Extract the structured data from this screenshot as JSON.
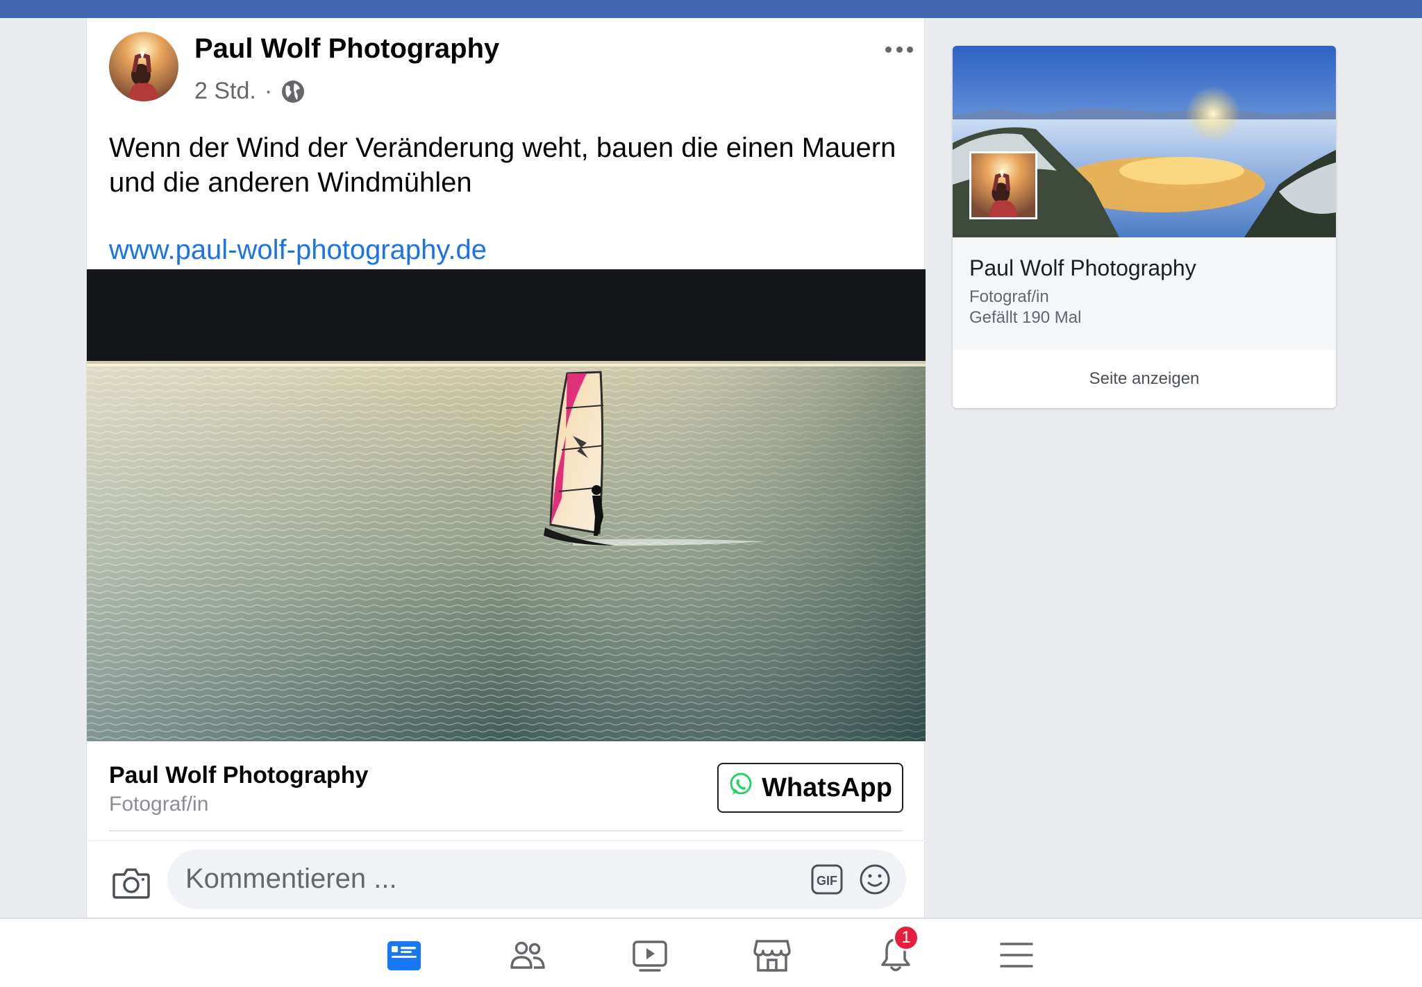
{
  "post": {
    "author": "Paul Wolf Photography",
    "time": "2 Std.",
    "separator": "·",
    "text": "Wenn der Wind der Veränderung weht, bauen die einen Mauern und die anderen Windmühlen",
    "link": "www.paul-wolf-photography.de",
    "cta": {
      "page_name": "Paul Wolf Photography",
      "category": "Fotograf/in",
      "button_label": "WhatsApp",
      "button_icon": "whatsapp-icon"
    },
    "comment": {
      "placeholder": "Kommentieren ..."
    }
  },
  "page_card": {
    "name": "Paul Wolf Photography",
    "category": "Fotograf/in",
    "likes": "Gefällt 190 Mal",
    "button_label": "Seite anzeigen"
  },
  "bottom_nav": {
    "items": [
      {
        "name": "news-feed",
        "icon": "news-feed-icon",
        "active": true
      },
      {
        "name": "friends",
        "icon": "friends-icon"
      },
      {
        "name": "watch",
        "icon": "video-icon"
      },
      {
        "name": "marketplace",
        "icon": "marketplace-icon"
      },
      {
        "name": "notifications",
        "icon": "bell-icon",
        "badge": "1"
      },
      {
        "name": "menu",
        "icon": "hamburger-menu-icon"
      }
    ]
  },
  "colors": {
    "topbar": "#4267b2",
    "link": "#1b74e4",
    "active_nav": "#1877f2",
    "badge": "#e41e3f",
    "whatsapp": "#25d366"
  }
}
